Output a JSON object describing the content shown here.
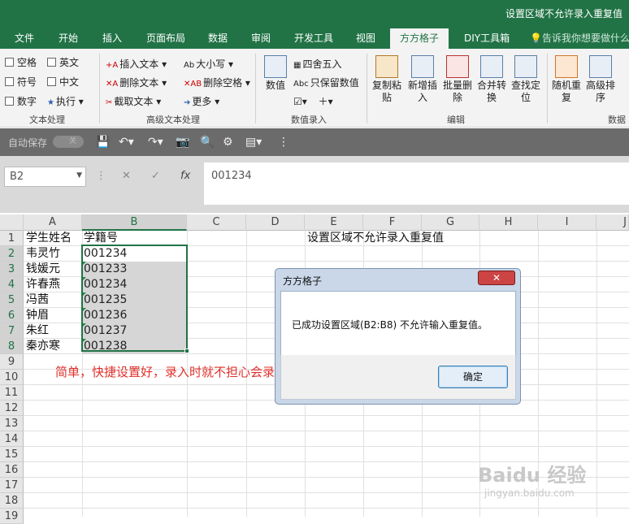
{
  "window": {
    "title": "设置区域不允许录入重复值"
  },
  "tabs": [
    "文件",
    "开始",
    "插入",
    "页面布局",
    "数据",
    "审阅",
    "开发工具",
    "视图",
    "方方格子",
    "DIY工具箱"
  ],
  "active_tab": "方方格子",
  "tell_me": "告诉我你想要做什么",
  "ribbon": {
    "text_processing": {
      "items": [
        "空格",
        "英文",
        "符号",
        "中文",
        "数字",
        "执行"
      ],
      "group": "文本处理"
    },
    "advanced_text": {
      "items": [
        "插入文本",
        "删除文本",
        "截取文本",
        "大小写",
        "删除空格",
        "更多"
      ],
      "group": "高级文本处理"
    },
    "number_entry": {
      "items": [
        "四舍五入",
        "只保留数值",
        "数值"
      ],
      "group": "数值录入"
    },
    "edit": {
      "items": [
        "复制粘贴",
        "新增插入",
        "批量删除",
        "合并转换",
        "查找定位"
      ],
      "group": "编辑"
    },
    "data": {
      "items": [
        "随机重复",
        "高级排序"
      ],
      "group": "数据"
    }
  },
  "qat": {
    "autosave": "自动保存",
    "toggle": "关"
  },
  "formula_bar": {
    "name_box": "B2",
    "formula": "001234"
  },
  "columns": [
    "A",
    "B",
    "C",
    "D",
    "E",
    "F",
    "G",
    "H",
    "I",
    "J"
  ],
  "rows": [
    "1",
    "2",
    "3",
    "4",
    "5",
    "6",
    "7",
    "8",
    "9",
    "10",
    "11",
    "12",
    "13",
    "14",
    "15",
    "16",
    "17",
    "18",
    "19"
  ],
  "cells": {
    "A1": "学生姓名",
    "B1": "学籍号",
    "E1": "设置区域不允许录入重复值",
    "names": [
      "韦灵竹",
      "钱媛元",
      "许春燕",
      "冯茜",
      "钟眉",
      "朱红",
      "秦亦寒"
    ],
    "ids": [
      "001234",
      "001233",
      "001234",
      "001235",
      "001236",
      "001237",
      "001238"
    ]
  },
  "annotation": "简单，快捷设置好，录入时就不担心会录入重复值了",
  "dialog": {
    "title": "方方格子",
    "close": "✕",
    "message": "已成功设置区域(B2:B8) 不允许输入重复值。",
    "ok": "确定"
  },
  "watermark": {
    "main": "Baidu 经验",
    "sub": "jingyan.baidu.com"
  },
  "colors": {
    "excel_green": "#217346",
    "annotation_red": "#e0302a"
  }
}
